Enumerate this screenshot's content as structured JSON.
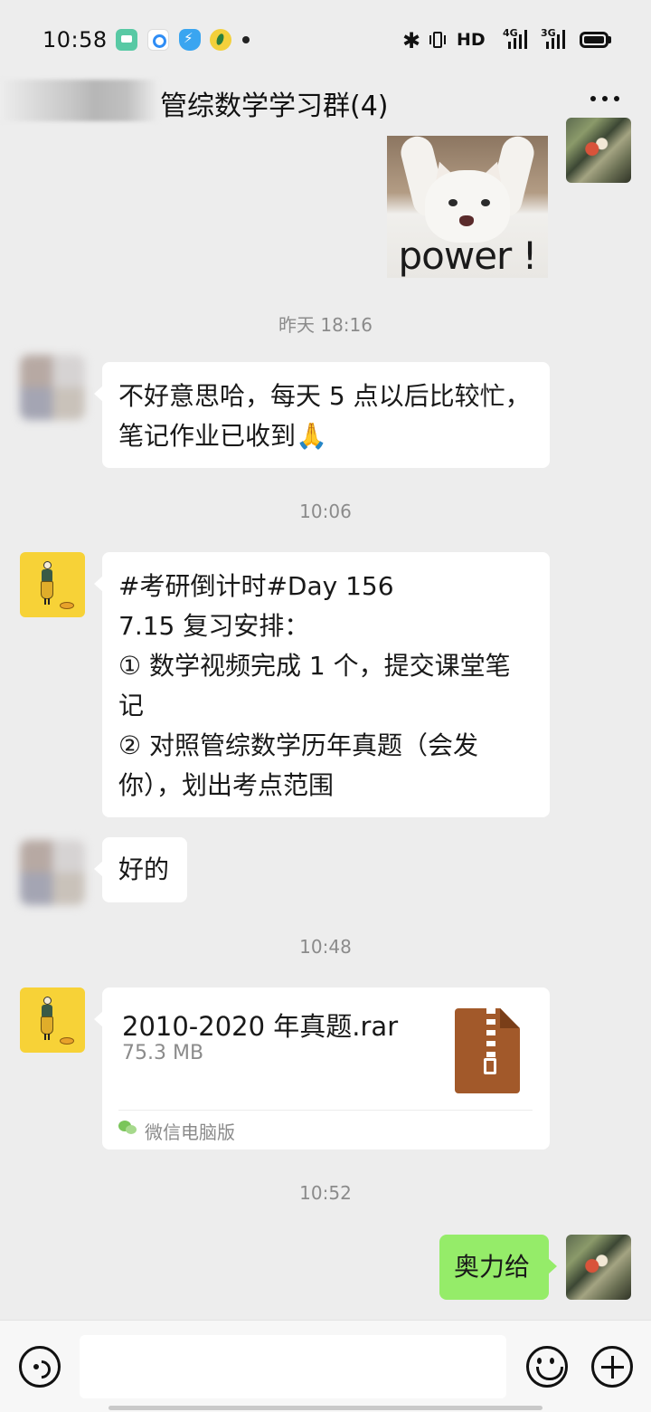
{
  "status_bar": {
    "time": "10:58",
    "network_label": "HD",
    "signal_1_label": "4G",
    "signal_2_label": "3G",
    "icons": [
      "messages-app-icon",
      "browser-app-icon",
      "security-app-icon",
      "music-app-icon",
      "bluetooth-icon",
      "vibrate-icon",
      "battery-icon"
    ]
  },
  "header": {
    "title": "管综数学学习群(4)",
    "more_icon": "more-dots-icon"
  },
  "sticker": {
    "caption": "power !"
  },
  "timestamps": {
    "t1": "昨天 18:16",
    "t2": "10:06",
    "t3": "10:48",
    "t4": "10:52"
  },
  "messages": {
    "m1": "不好意思哈，每天 5 点以后比较忙，\n笔记作业已收到🙏",
    "m2": "#考研倒计时#Day 156\n7.15 复习安排：\n① 数学视频完成 1 个，提交课堂笔\n记\n② 对照管综数学历年真题（会发\n你），划出考点范围",
    "m3": "好的",
    "m4": "奥力给"
  },
  "file_message": {
    "name": "2010-2020 年真题.rar",
    "size": "75.3 MB",
    "source": "微信电脑版",
    "icon": "zip-file-icon"
  },
  "input_bar": {
    "value": "",
    "voice_icon": "voice-icon",
    "emoji_icon": "emoji-icon",
    "plus_icon": "plus-icon"
  },
  "colors": {
    "background": "#ededed",
    "bubble_self": "#95ec69",
    "bubble_other": "#ffffff",
    "timestamp": "#8b8b8b"
  }
}
